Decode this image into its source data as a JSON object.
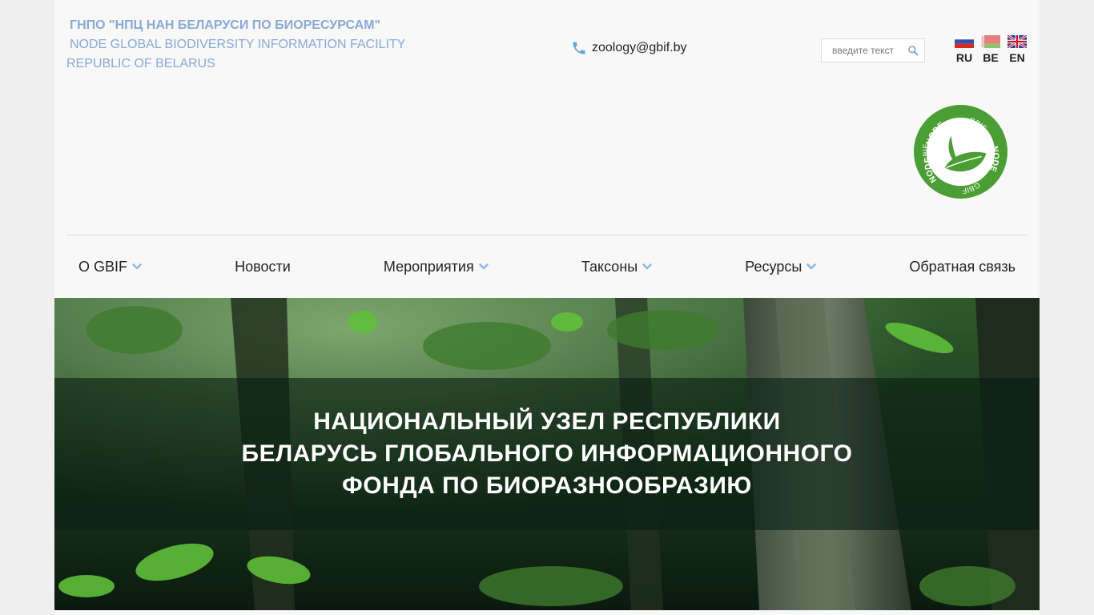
{
  "header": {
    "org_line1": "ГНПО \"НПЦ НАН БЕЛАРУСИ ПО БИОРЕСУРСАМ\"",
    "org_line2": "NODE GLOBAL BIODIVERSITY INFORMATION FACILITY",
    "org_line3": "REPUBLIC OF BELARUS",
    "email": "zoology@gbif.by",
    "search_placeholder": "введите текст",
    "languages": [
      {
        "code": "RU"
      },
      {
        "code": "BE"
      },
      {
        "code": "EN"
      }
    ]
  },
  "logo": {
    "top_text": "NODE",
    "right_text": "NODE",
    "left_text": "GBIF",
    "gbif_text": "GBIF",
    "color": "#4a9e34"
  },
  "nav": {
    "items": [
      {
        "label": "О GBIF",
        "has_dropdown": true
      },
      {
        "label": "Новости",
        "has_dropdown": false
      },
      {
        "label": "Мероприятия",
        "has_dropdown": true
      },
      {
        "label": "Таксоны",
        "has_dropdown": true
      },
      {
        "label": "Ресурсы",
        "has_dropdown": true
      },
      {
        "label": "Обратная связь",
        "has_dropdown": false
      }
    ]
  },
  "hero": {
    "title_line1": "НАЦИОНАЛЬНЫЙ УЗЕЛ РЕСПУБЛИКИ",
    "title_line2": "БЕЛАРУСЬ ГЛОБАЛЬНОГО ИНФОРМАЦИОННОГО",
    "title_line3": "ФОНДА ПО БИОРАЗНООБРАЗИЮ"
  },
  "colors": {
    "accent": "#8aa9d6",
    "icon_blue": "#5aa9d6",
    "chevron": "#8fb8e0"
  }
}
